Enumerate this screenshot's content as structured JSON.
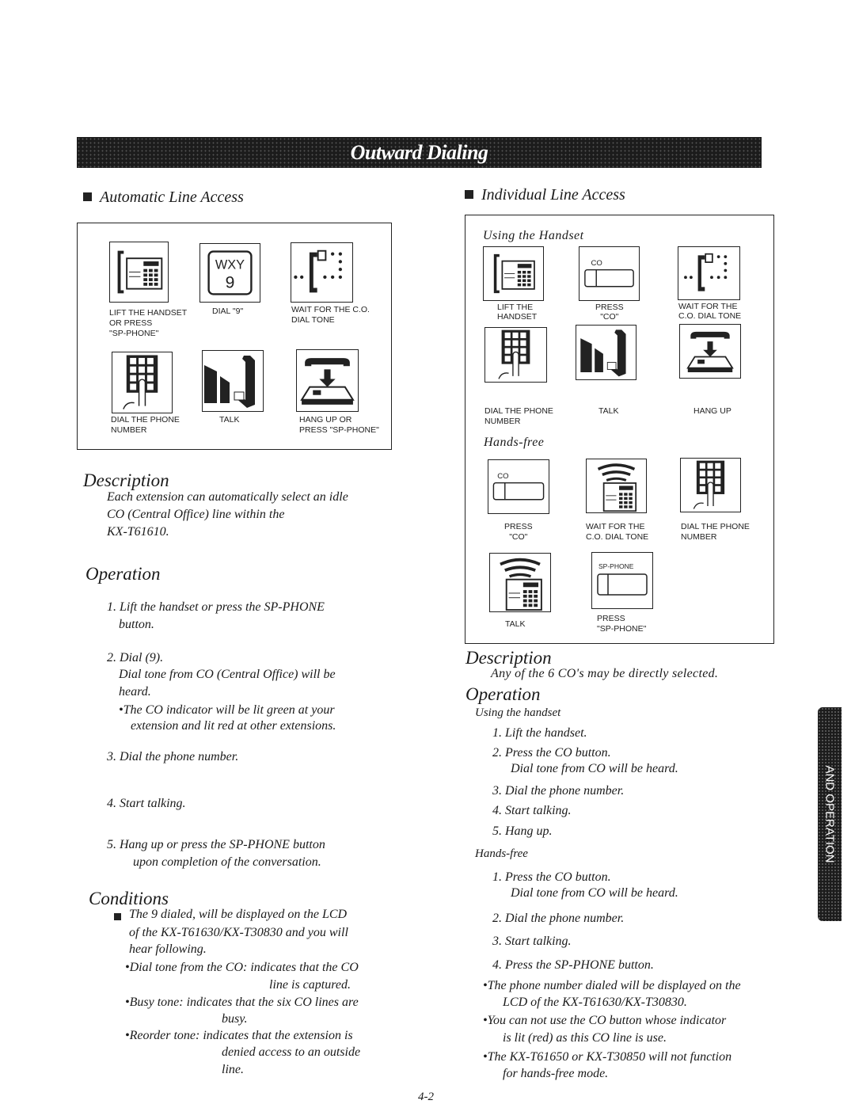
{
  "banner_title": "Outward Dialing",
  "automatic": {
    "heading": "Automatic Line Access",
    "steps": [
      {
        "icon": "handset-phone-icon",
        "label1": "LIFT THE HANDSET",
        "label2": "OR PRESS",
        "label3": "\"SP-PHONE\""
      },
      {
        "icon": "dial-9-key-icon",
        "key_letters": "WXY",
        "key_digit": "9",
        "label1": "DIAL \"9\""
      },
      {
        "icon": "dial-tone-icon",
        "label1": "WAIT FOR THE C.O.",
        "label2": "DIAL TONE"
      },
      {
        "icon": "keypad-icon",
        "label1": "DIAL THE PHONE",
        "label2": "NUMBER"
      },
      {
        "icon": "talk-icon",
        "label1": "TALK"
      },
      {
        "icon": "hang-up-icon",
        "label1": "HANG UP OR",
        "label2": "PRESS \"SP-PHONE\""
      }
    ]
  },
  "left_description": {
    "heading": "Description",
    "lines": [
      "Each extension can automatically select an idle",
      "CO   (Central   Office)   line   within   the",
      "KX-T61610."
    ]
  },
  "left_operation": {
    "heading": "Operation",
    "lines": [
      "1. Lift the handset or press the SP-PHONE",
      "button.",
      "2. Dial (9).",
      "Dial tone from CO (Central Office) will be",
      "heard.",
      "•The CO indicator will be lit green at your",
      "extension and lit red at other extensions.",
      "3. Dial the phone number.",
      "4. Start talking.",
      "5. Hang up or press the SP-PHONE button",
      "upon completion of the conversation."
    ]
  },
  "conditions": {
    "heading": "Conditions",
    "lines": [
      "The 9 dialed, will be displayed on the LCD",
      "of the KX-T61630/KX-T30830 and you will",
      "hear following.",
      "•Dial tone from the CO: indicates that the CO",
      "line is captured.",
      "•Busy tone: indicates that the six CO lines are",
      "busy.",
      "•Reorder tone: indicates that the extension is",
      "denied access to an outside",
      "line."
    ]
  },
  "individual": {
    "heading": "Individual Line Access",
    "handset_title": "Using the Handset",
    "handset_steps": [
      {
        "icon": "handset-phone-icon",
        "label1": "LIFT THE",
        "label2": "HANDSET"
      },
      {
        "icon": "co-button-icon",
        "button_text": "CO",
        "label1": "PRESS",
        "label2": "\"CO\""
      },
      {
        "icon": "dial-tone-icon",
        "label1": "WAIT FOR THE",
        "label2": "C.O. DIAL TONE"
      },
      {
        "icon": "keypad-icon",
        "label1": "DIAL THE PHONE",
        "label2": "NUMBER"
      },
      {
        "icon": "talk-icon",
        "label1": "TALK"
      },
      {
        "icon": "hang-up-icon",
        "label1": "HANG UP"
      }
    ],
    "handsfree_title": "Hands-free",
    "handsfree_steps": [
      {
        "icon": "co-button-icon",
        "button_text": "CO",
        "label1": "PRESS",
        "label2": "\"CO\""
      },
      {
        "icon": "speakerphone-icon",
        "label1": "WAIT FOR THE",
        "label2": "C.O. DIAL TONE"
      },
      {
        "icon": "keypad-icon",
        "label1": "DIAL THE PHONE",
        "label2": "NUMBER"
      },
      {
        "icon": "speakerphone-icon",
        "label1": "TALK"
      },
      {
        "icon": "sp-phone-button-icon",
        "button_text": "SP-PHONE",
        "label1": "PRESS",
        "label2": "\"SP-PHONE\""
      }
    ]
  },
  "right_description": {
    "heading": "Description",
    "lines": [
      "Any of the 6 CO's may be directly selected."
    ]
  },
  "right_operation": {
    "heading": "Operation",
    "handset_title": "Using the handset",
    "handset_lines": [
      "1. Lift the handset.",
      "2. Press the CO button.",
      "Dial tone from CO will be heard.",
      "3. Dial the phone number.",
      "4. Start talking.",
      "5. Hang up."
    ],
    "handsfree_title": "Hands-free",
    "handsfree_lines": [
      "1. Press the CO button.",
      "Dial tone from CO will be heard.",
      "2. Dial the phone number.",
      "3. Start talking.",
      "4. Press the SP-PHONE button.",
      "•The phone number dialed will be displayed on the",
      "LCD of the KX-T61630/KX-T30830.",
      "•You can not use the CO button whose indicator",
      "is lit (red) as this CO line is use.",
      "•The KX-T61650 or KX-T30850 will not function",
      "for hands-free mode."
    ]
  },
  "side_tab": "AND OPERATION",
  "page_number": "4-2"
}
